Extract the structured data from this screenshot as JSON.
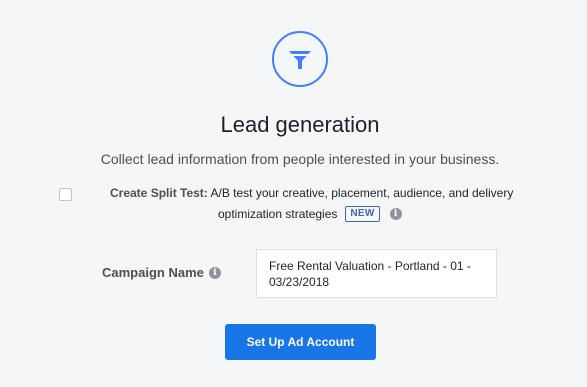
{
  "header": {
    "icon": "funnel-icon",
    "title": "Lead generation",
    "subtitle": "Collect lead information from people interested in your business."
  },
  "split_test": {
    "checked": false,
    "label_bold": "Create Split Test:",
    "label_line1": " A/B test your creative, placement, audience, and delivery",
    "label_line2": "optimization strategies",
    "badge": "NEW",
    "info_icon": "info-icon"
  },
  "campaign": {
    "label": "Campaign Name",
    "info_icon": "info-icon",
    "value": "Free Rental Valuation - Portland - 01 -\n03/23/2018"
  },
  "actions": {
    "setup_label": "Set Up Ad Account"
  },
  "colors": {
    "accent": "#4080ff",
    "button": "#1876e8",
    "badge": "#4267b2"
  }
}
